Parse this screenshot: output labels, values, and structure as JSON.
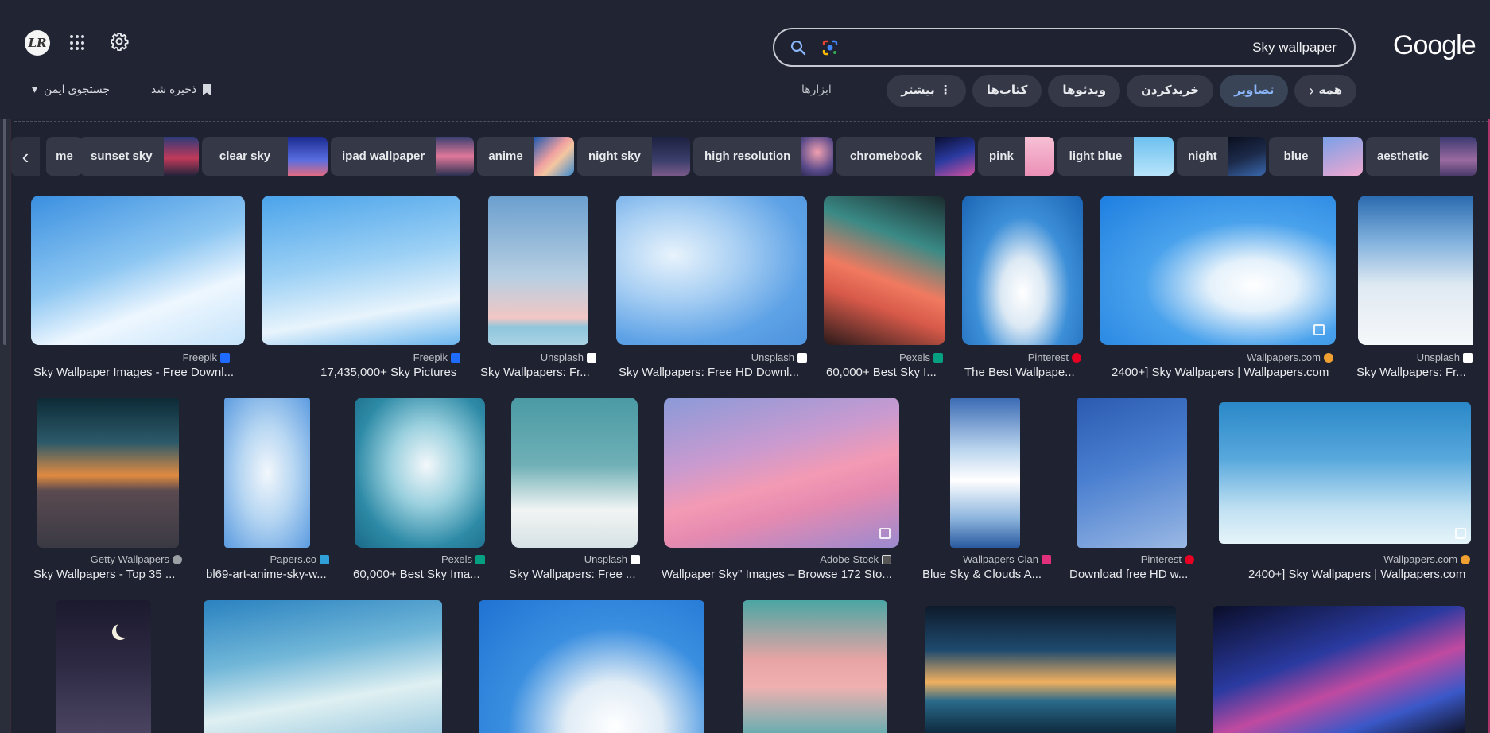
{
  "header": {
    "avatar_initials": "LR",
    "logo": "Google",
    "search_query": "Sky wallpaper",
    "tools_label": "ابزارها",
    "safe_search_label": "جستجوی ایمن",
    "saved_label": "ذخیره شد"
  },
  "tabs": [
    {
      "label": "همه",
      "chevron": "›"
    },
    {
      "label": "تصاویر"
    },
    {
      "label": "خریدکردن"
    },
    {
      "label": "ویدئوها"
    },
    {
      "label": "کتاب‌ها"
    },
    {
      "label": "بیشتر",
      "icon": "⋮"
    }
  ],
  "chips": [
    {
      "label": "me"
    },
    {
      "label": "sunset sky"
    },
    {
      "label": "clear sky"
    },
    {
      "label": "ipad wallpaper"
    },
    {
      "label": "anime"
    },
    {
      "label": "night sky"
    },
    {
      "label": "high resolution"
    },
    {
      "label": "chromebook"
    },
    {
      "label": "pink"
    },
    {
      "label": "light blue"
    },
    {
      "label": "night"
    },
    {
      "label": "blue"
    },
    {
      "label": "aesthetic"
    }
  ],
  "results": [
    {
      "source": "Freepik",
      "title": "Sky Wallpaper Images - Free Downl...",
      "fav_color": "#1f6bff"
    },
    {
      "source": "Freepik",
      "title": "17,435,000+ Sky Pictures",
      "fav_color": "#1f6bff"
    },
    {
      "source": "Unsplash",
      "title": "Sky Wallpapers: Fr...",
      "fav_color": "#ffffff"
    },
    {
      "source": "Unsplash",
      "title": "Sky Wallpapers: Free HD Downl...",
      "fav_color": "#ffffff"
    },
    {
      "source": "Pexels",
      "title": "60,000+ Best Sky I...",
      "fav_color": "#05a081"
    },
    {
      "source": "Pinterest",
      "title": "The Best Wallpape...",
      "fav_color": "#e60023"
    },
    {
      "source": "Wallpapers.com",
      "title": "2400+] Sky Wallpapers | Wallpapers.com",
      "fav_color": "#f0a030"
    },
    {
      "source": "Unsplash",
      "title": "Sky Wallpapers: Fr...",
      "fav_color": "#ffffff"
    },
    {
      "source": "Getty Wallpapers",
      "title": "Sky Wallpapers - Top 35 ...",
      "fav_color": "#9aa0a6"
    },
    {
      "source": "Papers.co",
      "title": "bl69-art-anime-sky-w...",
      "fav_color": "#2fa0d8"
    },
    {
      "source": "Pexels",
      "title": "60,000+ Best Sky Ima...",
      "fav_color": "#05a081"
    },
    {
      "source": "Unsplash",
      "title": "Sky Wallpapers: Free ...",
      "fav_color": "#ffffff"
    },
    {
      "source": "Adobe Stock",
      "title": "Wallpaper Sky\" Images – Browse 172 Sto...",
      "fav_color": "#555555"
    },
    {
      "source": "Wallpapers Clan",
      "title": "Blue Sky & Clouds A...",
      "fav_color": "#e0307a"
    },
    {
      "source": "Pinterest",
      "title": "Download free HD w...",
      "fav_color": "#e60023"
    },
    {
      "source": "Wallpapers.com",
      "title": "2400+] Sky Wallpapers | Wallpapers.com",
      "fav_color": "#f0a030"
    }
  ]
}
